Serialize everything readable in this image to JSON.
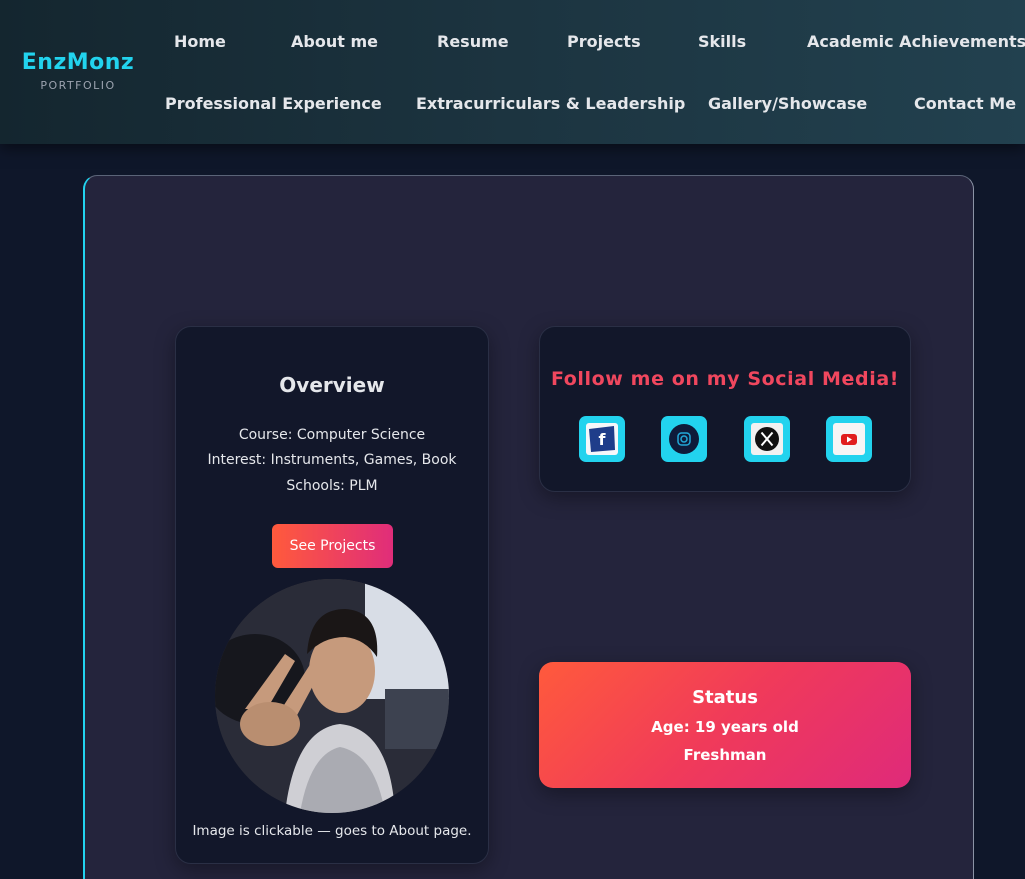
{
  "brand": {
    "name": "EnzMonz",
    "subtitle": "PORTFOLIO"
  },
  "nav": {
    "row1": [
      "Home",
      "About me",
      "Resume",
      "Projects",
      "Skills",
      "Academic Achievements"
    ],
    "row2": [
      "Professional Experience",
      "Extracurriculars & Leadership",
      "Gallery/Showcase",
      "Contact Me"
    ]
  },
  "overview": {
    "title": "Overview",
    "course": "Course: Computer Science",
    "interest": "Interest: Instruments, Games, Book",
    "schools": "Schools: PLM",
    "button_label": "See Projects",
    "caption": "Image is clickable — goes to About page."
  },
  "social": {
    "title": "Follow me on my Social Media!",
    "icons": [
      "facebook-icon",
      "instagram-icon",
      "x-icon",
      "youtube-icon"
    ]
  },
  "status": {
    "title": "Status",
    "age": "Age: 19 years old",
    "year": "Freshman"
  },
  "colors": {
    "accent_cyan": "#22d3ee",
    "gradient_start": "#ff5a3c",
    "gradient_end": "#df2a7a",
    "page_bg": "#0f172a",
    "panel_bg": "#24243c",
    "card_bg": "#12172a"
  }
}
